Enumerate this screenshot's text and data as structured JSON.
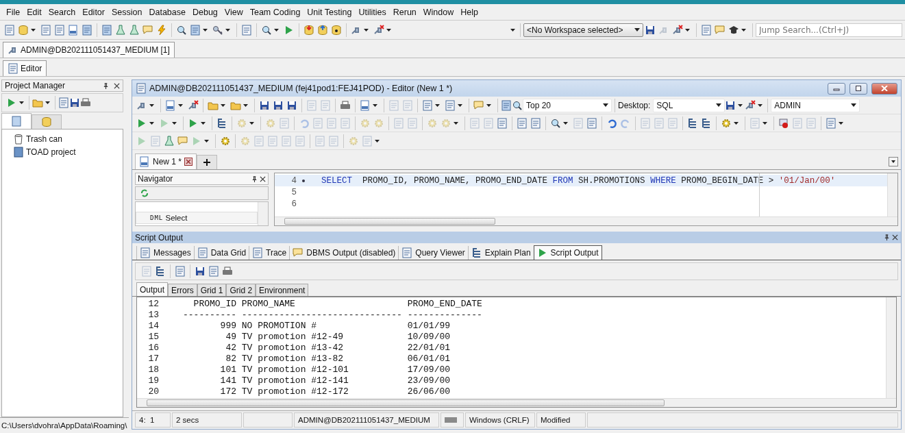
{
  "menu": [
    "File",
    "Edit",
    "Search",
    "Editor",
    "Session",
    "Database",
    "Debug",
    "View",
    "Team Coding",
    "Unit Testing",
    "Utilities",
    "Rerun",
    "Window",
    "Help"
  ],
  "toolbar": {
    "workspace": "<No Workspace selected>",
    "jump_search": {
      "placeholder": "Jump Search...(Ctrl+J)"
    }
  },
  "connection_tabs": [
    {
      "label": "ADMIN@DB202111051437_MEDIUM [1]",
      "selected": true
    }
  ],
  "window_tabs": [
    {
      "label": "Editor",
      "selected": true
    }
  ],
  "project_manager": {
    "title": "Project Manager",
    "tabs": [
      {
        "selected": true
      },
      {
        "selected": false
      }
    ],
    "tree": [
      {
        "label": "Trash can",
        "kind": "trash"
      },
      {
        "label": "TOAD project",
        "kind": "project"
      }
    ],
    "status": "C:\\Users\\dvohra\\AppData\\Roaming\\"
  },
  "editor": {
    "title": "ADMIN@DB202111051437_MEDIUM (fej41pod1:FEJ41POD) - Editor (New 1 *)",
    "row_limit": "Top 20",
    "desktop_label": "Desktop:",
    "desktop": "SQL",
    "schema": "ADMIN",
    "tabs": [
      {
        "label": "New 1 *",
        "selected": true
      }
    ],
    "navigator": {
      "title": "Navigator",
      "items": [
        {
          "prefix": "DML",
          "label": "Select"
        }
      ]
    },
    "lines": [
      {
        "number": "4",
        "current": true,
        "tokens": [
          {
            "kind": "keyword",
            "text": "SELECT"
          },
          {
            "kind": "plain",
            "text": "  PROMO_ID, PROMO_NAME, PROMO_END_DATE "
          },
          {
            "kind": "keyword",
            "text": "FROM"
          },
          {
            "kind": "plain",
            "text": " SH.PROMOTIONS "
          },
          {
            "kind": "keyword",
            "text": "WHERE"
          },
          {
            "kind": "plain",
            "text": " PROMO_BEGIN_DATE > "
          },
          {
            "kind": "string",
            "text": "'01/Jan/00'"
          }
        ]
      },
      {
        "number": "5",
        "current": false
      },
      {
        "number": "6",
        "current": false
      }
    ]
  },
  "output": {
    "title": "Script Output",
    "tabs": [
      {
        "label": "Messages",
        "selected": false
      },
      {
        "label": "Data Grid",
        "selected": false
      },
      {
        "label": "Trace",
        "selected": false
      },
      {
        "label": "DBMS Output (disabled)",
        "selected": false
      },
      {
        "label": "Query Viewer",
        "selected": false
      },
      {
        "label": "Explain Plan",
        "selected": false
      },
      {
        "label": "Script Output",
        "selected": true
      }
    ],
    "subtabs": [
      {
        "label": "Output",
        "selected": true
      },
      {
        "label": "Errors",
        "selected": false
      },
      {
        "label": "Grid 1",
        "selected": false
      },
      {
        "label": "Grid 2",
        "selected": false
      },
      {
        "label": "Environment",
        "selected": false
      }
    ],
    "lines": [
      {
        "number": "12",
        "text": "  PROMO_ID PROMO_NAME                     PROMO_END_DATE"
      },
      {
        "number": "13",
        "text": "---------- ------------------------------ --------------"
      },
      {
        "number": "14",
        "text": "       999 NO PROMOTION #                 01/01/99"
      },
      {
        "number": "15",
        "text": "        49 TV promotion #12-49            10/09/00"
      },
      {
        "number": "16",
        "text": "        42 TV promotion #13-42            22/01/01"
      },
      {
        "number": "17",
        "text": "        82 TV promotion #13-82            06/01/01"
      },
      {
        "number": "18",
        "text": "       101 TV promotion #12-101           17/09/00"
      },
      {
        "number": "19",
        "text": "       141 TV promotion #12-141           23/09/00"
      },
      {
        "number": "20",
        "text": "       172 TV promotion #12-172           26/06/00"
      }
    ]
  },
  "status_bar": {
    "position": "4:  1",
    "elapsed": "2 secs",
    "connection": "ADMIN@DB202111051437_MEDIUM",
    "line_endings": "Windows (CRLF)",
    "state": "Modified"
  }
}
